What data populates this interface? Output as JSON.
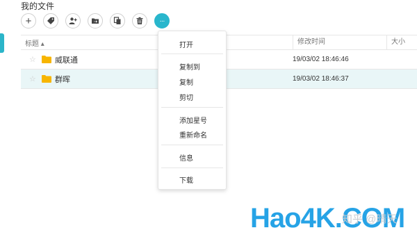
{
  "page": {
    "title": "我的文件"
  },
  "toolbar": {
    "buttons": [
      {
        "name": "add",
        "glyph": "+"
      },
      {
        "name": "tag",
        "glyph": ""
      },
      {
        "name": "add-user",
        "glyph": ""
      },
      {
        "name": "move",
        "glyph": ""
      },
      {
        "name": "copy",
        "glyph": ""
      },
      {
        "name": "delete",
        "glyph": ""
      },
      {
        "name": "more",
        "glyph": "···"
      }
    ]
  },
  "table": {
    "headers": {
      "title": "标题 ▴",
      "time": "修改时间",
      "size": "大小"
    },
    "rows": [
      {
        "star": "☆",
        "name": "威联通",
        "time": "19/03/02 18:46:46"
      },
      {
        "star": "☆",
        "name": "群晖",
        "time": "19/03/02 18:46:37"
      }
    ]
  },
  "context_menu": {
    "items": [
      "打开",
      "复制到",
      "复制",
      "剪切",
      "添加星号",
      "重新命名",
      "信息",
      "下载"
    ]
  },
  "watermark": {
    "site": "Hao4K.COM",
    "zh": "知乎 @晴天"
  },
  "colors": {
    "accent": "#29b6cc",
    "folder": "#f7b500",
    "row_selected": "#e9f6f7"
  }
}
